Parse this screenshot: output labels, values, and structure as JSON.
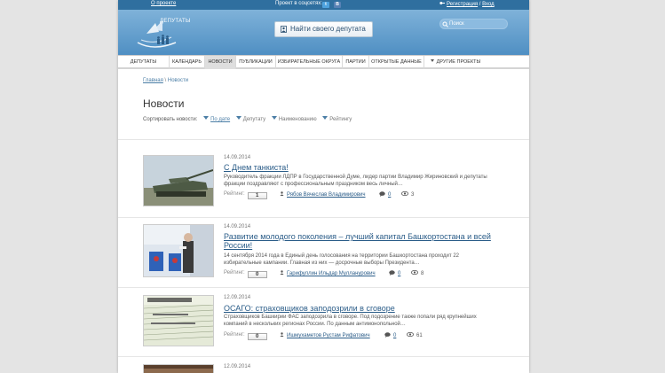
{
  "topbar": {
    "about": "О проекте",
    "social_label": "Проект в соцсетях:",
    "twitter": "t",
    "vk": "B",
    "register": "Регистрация",
    "auth_sep": " / ",
    "login": "Вход"
  },
  "header": {
    "logo_text": "ДЕПУТАТЫ",
    "find_button": "Найти своего депутата",
    "search_placeholder": "Поиск"
  },
  "nav": {
    "items": [
      {
        "label": "ДЕПУТАТЫ"
      },
      {
        "label": "КАЛЕНДАРЬ"
      },
      {
        "label": "НОВОСТИ"
      },
      {
        "label": "ПУБЛИКАЦИИ"
      },
      {
        "label": "ИЗБИРАТЕЛЬНЫЕ ОКРУГА"
      },
      {
        "label": "ПАРТИИ"
      },
      {
        "label": "ОТКРЫТЫЕ ДАННЫЕ"
      },
      {
        "label": "ДРУГИЕ ПРОЕКТЫ"
      }
    ],
    "active_index": 2
  },
  "breadcrumb": {
    "home": "Главная",
    "sep": " \\ ",
    "current": "Новости"
  },
  "page_title": "Новости",
  "sort": {
    "label": "Сортировать новости:",
    "options": [
      "По дате",
      "Депутату",
      "Наименованию",
      "Рейтингу"
    ],
    "selected_index": 0
  },
  "rating_label": "Рейтинг:",
  "news": [
    {
      "date": "14.09.2014",
      "title": "С Днем танкиста!",
      "excerpt": "Руководитель фракции ЛДПР в Государственной Думе, лидер партии Владимир Жириновский и депутаты фракции поздравляют с профессиональным праздником весь личный…",
      "rating": "1",
      "author": "Рябов Вячеслав Владимирович",
      "comments": "0",
      "views": "3",
      "thumb": "tank"
    },
    {
      "date": "14.09.2014",
      "title": "Развитие молодого поколения – лучший капитал Башкортостана и всей России!",
      "excerpt": "14 сентября 2014 года в Единый день голосования на территории Башкортостана проходит 22 избирательные кампании. Главная из них — досрочные выборы Президента…",
      "rating": "0",
      "author": "Гарифуллин Ильдар Мулланурович",
      "comments": "0",
      "views": "8",
      "thumb": "voting"
    },
    {
      "date": "12.09.2014",
      "title": "ОСАГО: страховщиков заподозрили в сговоре",
      "excerpt": "Страховщиков Башкирии ФАС заподозрила в сговоре. Под подозрение также попали ряд крупнейших компаний в нескольких регионах России. По данным антимонопольной…",
      "rating": "0",
      "author": "Ишмухаметов Рустам Рифатович",
      "comments": "0",
      "views": "61",
      "thumb": "policy"
    },
    {
      "date": "12.09.2014",
      "thumb": "partial"
    }
  ],
  "colors": {
    "topbar": "#2f6f9f",
    "header_gradient_top": "#7fb2d9",
    "header_gradient_bottom": "#4f8fc3",
    "link": "#2a5c88",
    "page_bg": "#e4e4e4"
  }
}
